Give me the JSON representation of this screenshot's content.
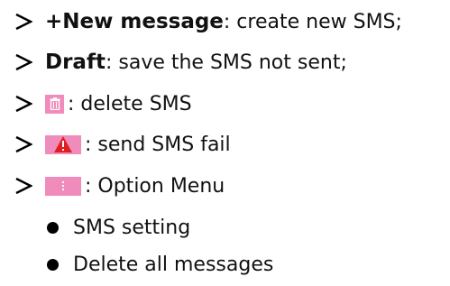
{
  "items": [
    {
      "label": "+New message",
      "desc": ": create new SMS;"
    },
    {
      "label": "Draft",
      "desc": ": save the SMS not sent;"
    },
    {
      "icon": "trash-icon",
      "desc": ": delete SMS"
    },
    {
      "icon": "warning-icon",
      "desc": ": send SMS fail"
    },
    {
      "icon": "more-vertical-icon",
      "desc": ": Option Menu"
    }
  ],
  "sub_items": [
    {
      "label": "SMS setting"
    },
    {
      "label": "Delete all messages"
    }
  ],
  "colors": {
    "icon_bg": "#f08cbc",
    "warning_red": "#e02020",
    "text": "#111111"
  }
}
